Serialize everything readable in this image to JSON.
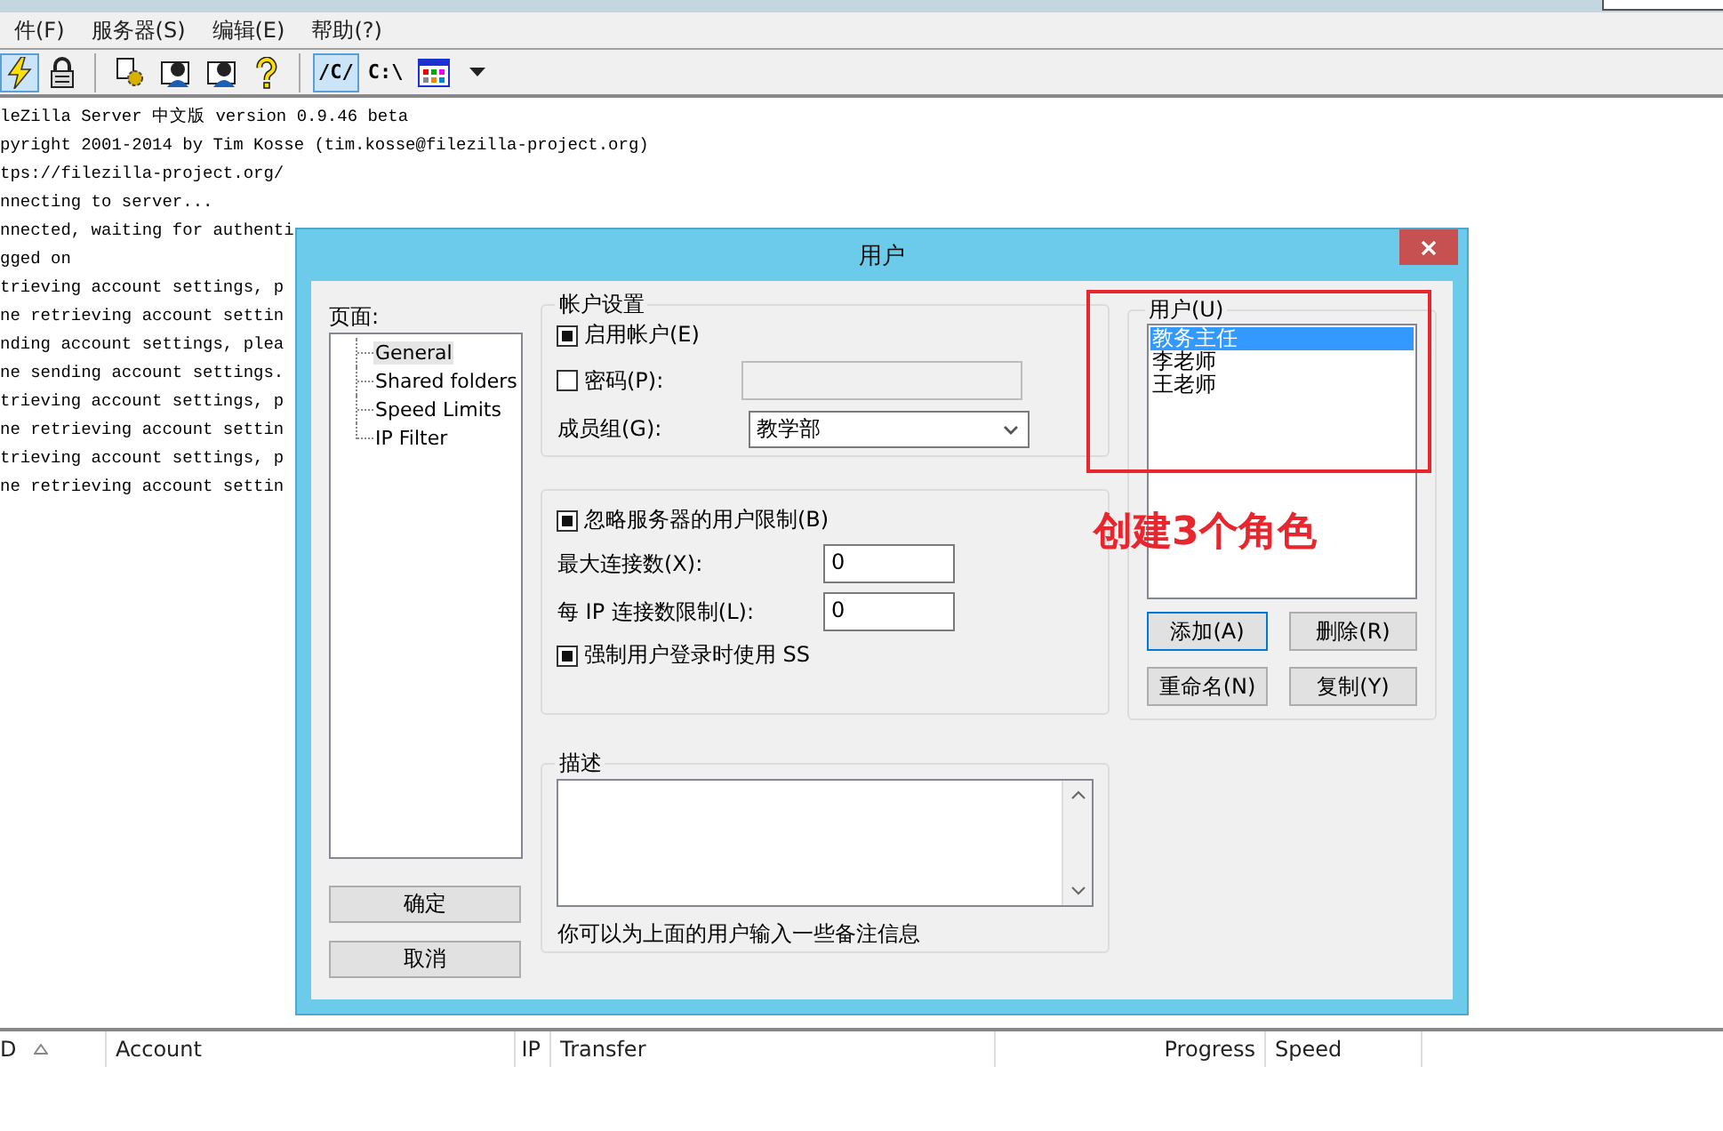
{
  "menu": [
    "件(F)",
    "服务器(S)",
    "编辑(E)",
    "帮助(?)"
  ],
  "toolbar": [
    {
      "kind": "lightning",
      "pressed": true
    },
    {
      "kind": "lock",
      "pressed": false
    },
    {
      "kind": "separator"
    },
    {
      "kind": "gear",
      "pressed": false
    },
    {
      "kind": "user",
      "pressed": false
    },
    {
      "kind": "user",
      "pressed": false
    },
    {
      "kind": "help",
      "pressed": false
    },
    {
      "kind": "separator"
    },
    {
      "kind": "text",
      "label": "/C/",
      "pressed": true
    },
    {
      "kind": "text",
      "label": "C:\\",
      "pressed": false
    },
    {
      "kind": "grid",
      "pressed": false
    },
    {
      "kind": "caret",
      "pressed": false
    }
  ],
  "log": [
    "leZilla Server 中文版 version 0.9.46 beta",
    "pyright 2001-2014 by Tim Kosse (tim.kosse@filezilla-project.org)",
    "tps://filezilla-project.org/",
    "nnecting to server...",
    "nnected, waiting for authenti",
    "gged on",
    "trieving account settings, p",
    "ne retrieving account settin",
    "nding account settings, plea",
    "ne sending account settings.",
    "trieving account settings, p",
    "ne retrieving account settin",
    "trieving account settings, p",
    "ne retrieving account settin"
  ],
  "dialog": {
    "title": "用户",
    "pages_label": "页面:",
    "pages": [
      {
        "label": "General",
        "selected": true
      },
      {
        "label": "Shared folders",
        "selected": false
      },
      {
        "label": "Speed Limits",
        "selected": false
      },
      {
        "label": "IP Filter",
        "selected": false
      }
    ],
    "ok": "确定",
    "cancel": "取消",
    "account": {
      "legend": "帐户设置",
      "enable": {
        "label": "启用帐户(E)",
        "checked": true
      },
      "password": {
        "label": "密码(P):",
        "checked": false,
        "disabled": true
      },
      "group": {
        "label": "成员组(G):",
        "value": "教学部"
      }
    },
    "limits": {
      "ignore": {
        "label": "忽略服务器的用户限制(B)",
        "checked": true
      },
      "fields": [
        {
          "label": "最大连接数(X):",
          "value": "0"
        },
        {
          "label": "每 IP 连接数限制(L):",
          "value": "0"
        }
      ],
      "force_ssl": {
        "label": "强制用户登录时使用 SS",
        "checked": true
      }
    },
    "description": {
      "legend": "描述",
      "hint": "你可以为上面的用户输入一些备注信息"
    },
    "users": {
      "legend": "用户(U)",
      "items": [
        {
          "label": "教务主任",
          "selected": true
        },
        {
          "label": "李老师",
          "selected": false
        },
        {
          "label": "王老师",
          "selected": false
        }
      ],
      "buttons": [
        {
          "label": "添加(A)",
          "focused": true
        },
        {
          "label": "删除(R)",
          "focused": false
        },
        {
          "label": "重命名(N)",
          "focused": false
        },
        {
          "label": "复制(Y)",
          "focused": false
        }
      ]
    }
  },
  "annotation": {
    "text": "创建3个角色"
  },
  "transfers": {
    "columns": [
      {
        "label": "D",
        "sorted": true
      },
      {
        "label": "Account",
        "sorted": false
      },
      {
        "label": "IP",
        "sorted": false
      },
      {
        "label": "Transfer",
        "sorted": false
      },
      {
        "label": "Progress",
        "sorted": false
      },
      {
        "label": "Speed",
        "sorted": false
      }
    ]
  }
}
